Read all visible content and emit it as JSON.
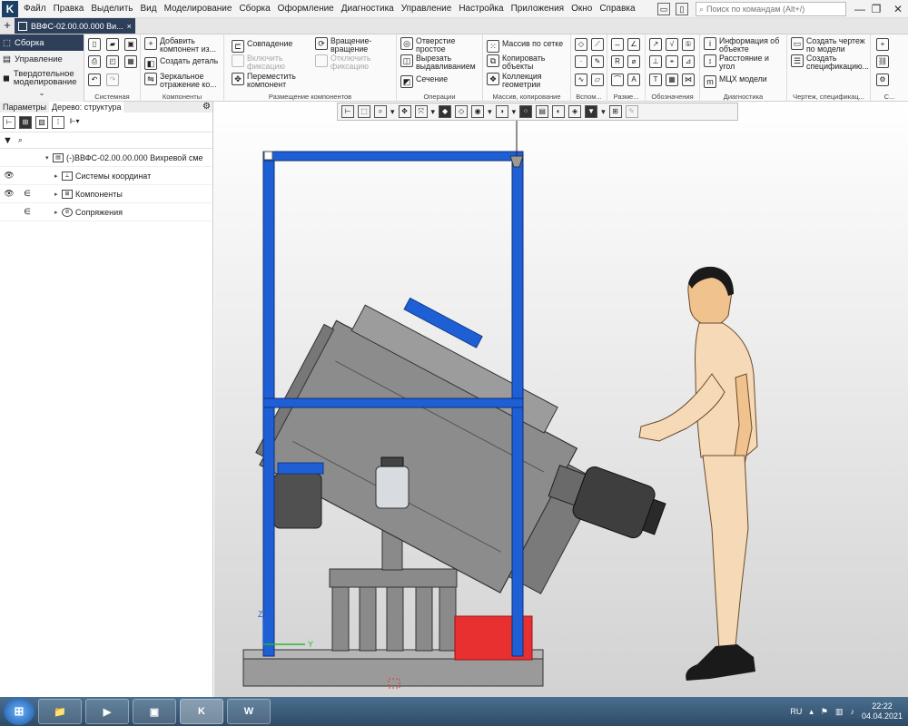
{
  "menu": {
    "items": [
      "Файл",
      "Правка",
      "Выделить",
      "Вид",
      "Моделирование",
      "Сборка",
      "Оформление",
      "Диагностика",
      "Управление",
      "Настройка",
      "Приложения",
      "Окно",
      "Справка"
    ],
    "search_placeholder": "Поиск по командам (Alt+/)"
  },
  "tab": {
    "label": "ВВФС-02.00.00.000 Ви...",
    "close": "×"
  },
  "modes": [
    {
      "label": "Сборка",
      "active": true
    },
    {
      "label": "Управление"
    },
    {
      "label": "Твердотельное\nмоделирование"
    }
  ],
  "ribbon": {
    "system_title": "Системная",
    "components": {
      "title": "Компоненты",
      "add": "Добавить\nкомпонент из...",
      "create": "Создать деталь",
      "mirror": "Зеркальное\nотражение ко..."
    },
    "placement": {
      "title": "Размещение компонентов",
      "coincide": "Совпадение",
      "rotation": "Вращение-\nвращение",
      "fix_on": "Включить\nфиксацию",
      "fix_off": "Отключить\nфиксацию",
      "move": "Переместить\nкомпонент"
    },
    "operations": {
      "title": "Операции",
      "hole": "Отверстие\nпростое",
      "cut": "Вырезать\nвыдавливанием",
      "section": "Сечение"
    },
    "array": {
      "title": "Массив, копирование",
      "grid": "Массив по сетке",
      "copy": "Копировать\nобъекты",
      "geom": "Коллекция\nгеометрии"
    },
    "aux_title": "Вспом...",
    "size_title": "Разме...",
    "marks_title": "Обозначения",
    "diagnostics": {
      "title": "Диагностика",
      "info": "Информация об\nобъекте",
      "distance": "Расстояние и\nугол",
      "mass": "МЦХ модели"
    },
    "drawing": {
      "title": "Чертеж, спецификац...",
      "create_drawing": "Создать чертеж\nпо модели",
      "create_spec": "Создать\nспецификацию..."
    },
    "extra_title": "С..."
  },
  "left_panel": {
    "tab_params": "Параметры",
    "tab_tree": "Дерево: структура",
    "tree": [
      {
        "label": "(-)ВВФС-02.00.00.000 Вихревой сме",
        "eye": "",
        "incl": ""
      },
      {
        "label": "Системы координат",
        "eye": "👁",
        "incl": ""
      },
      {
        "label": "Компоненты",
        "eye": "👁",
        "incl": "∈"
      },
      {
        "label": "Сопряжения",
        "eye": "",
        "incl": "∈"
      }
    ]
  },
  "viewport": {
    "axis_y": "Y",
    "axis_z": "Z",
    "colors": {
      "frame": "#1f5fd6",
      "body": "#8a8a8a",
      "block": "#e83030",
      "skin": "#f0c28e",
      "shoe": "#1a1a1a"
    }
  },
  "taskbar": {
    "apps": [
      "📁",
      "▶",
      "▣",
      "K",
      "W"
    ],
    "lang": "RU",
    "time": "22:22",
    "date": "04.04.2021"
  }
}
